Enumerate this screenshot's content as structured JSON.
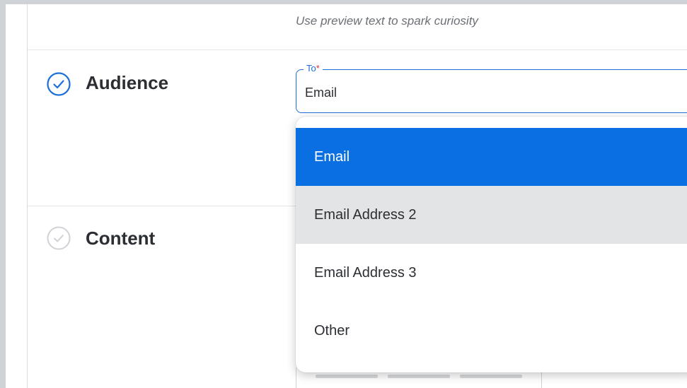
{
  "preview": {
    "hint": "Use preview text to spark curiosity"
  },
  "sections": {
    "audience": {
      "title": "Audience",
      "completed": true
    },
    "content": {
      "title": "Content",
      "completed": false
    }
  },
  "to_field": {
    "label": "To",
    "required_mark": "*",
    "value": "Email"
  },
  "dropdown": {
    "options": [
      "Email",
      "Email Address 2",
      "Email Address 3",
      "Other"
    ],
    "selected_index": 0,
    "hovered_index": 1
  },
  "colors": {
    "accent": "#0a6fe3",
    "focus_border": "#1d6fd8",
    "required": "#e0294a",
    "hover_bg": "#e3e4e6",
    "check_active": "#1d6fd8",
    "check_inactive": "#c9ccd0"
  },
  "icons": {
    "audience_status": "check-circle-icon",
    "content_status": "check-circle-icon"
  }
}
